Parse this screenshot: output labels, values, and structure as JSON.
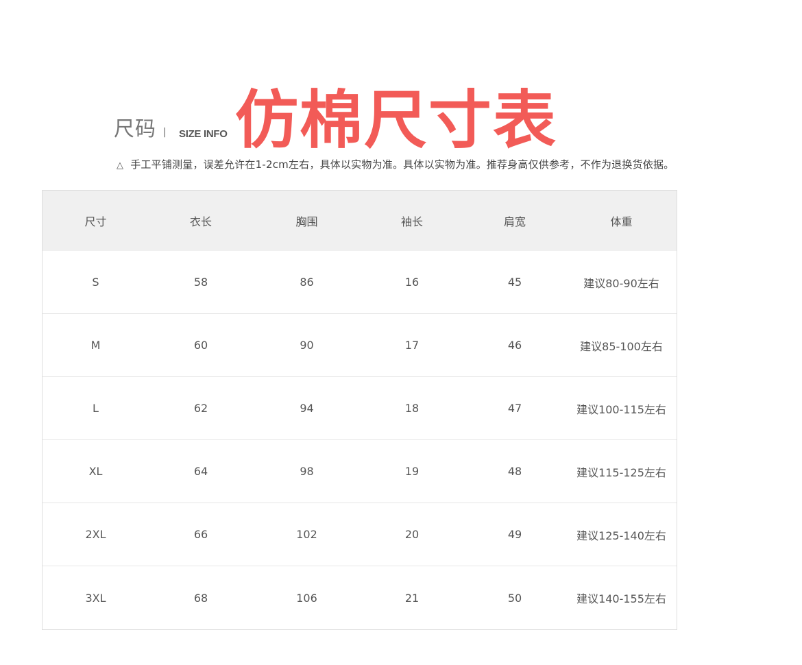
{
  "header": {
    "title_cn": "尺码",
    "separator": "|",
    "title_en": "SIZE INFO",
    "big_title": "仿棉尺寸表",
    "big_title_color": "#f25b57"
  },
  "note": {
    "icon": "triangle-warning-icon",
    "icon_glyph": "△",
    "text": "手工平铺测量，误差允许在1-2cm左右，具体以实物为准。具体以实物为准。推荐身高仅供参考，不作为退换货依据。"
  },
  "table": {
    "headers": [
      "尺寸",
      "衣长",
      "胸围",
      "袖长",
      "肩宽",
      "体重"
    ],
    "rows": [
      [
        "S",
        "58",
        "86",
        "16",
        "45",
        "建议80-90左右"
      ],
      [
        "M",
        "60",
        "90",
        "17",
        "46",
        "建议85-100左右"
      ],
      [
        "L",
        "62",
        "94",
        "18",
        "47",
        "建议100-115左右"
      ],
      [
        "XL",
        "64",
        "98",
        "19",
        "48",
        "建议115-125左右"
      ],
      [
        "2XL",
        "66",
        "102",
        "20",
        "49",
        "建议125-140左右"
      ],
      [
        "3XL",
        "68",
        "106",
        "21",
        "50",
        "建议140-155左右"
      ]
    ]
  }
}
